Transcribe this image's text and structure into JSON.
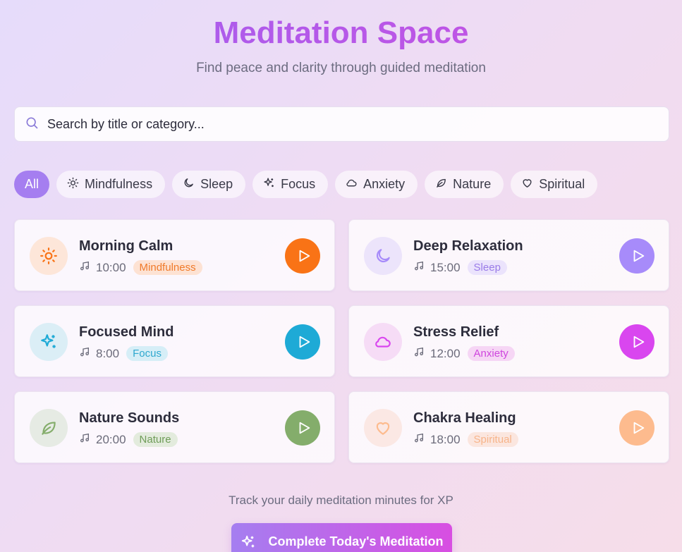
{
  "header": {
    "title": "Meditation Space",
    "subtitle": "Find peace and clarity through guided meditation"
  },
  "search": {
    "placeholder": "Search by title or category...",
    "value": ""
  },
  "filters": [
    {
      "label": "All",
      "icon": "none",
      "active": true
    },
    {
      "label": "Mindfulness",
      "icon": "sun-icon"
    },
    {
      "label": "Sleep",
      "icon": "moon-icon"
    },
    {
      "label": "Focus",
      "icon": "sparkles-icon"
    },
    {
      "label": "Anxiety",
      "icon": "cloud-icon"
    },
    {
      "label": "Nature",
      "icon": "leaf-icon"
    },
    {
      "label": "Spiritual",
      "icon": "heart-icon"
    }
  ],
  "sessions": [
    {
      "title": "Morning Calm",
      "duration": "10:00",
      "category": "Mindfulness",
      "icon": "sun-icon",
      "color": "#f97316"
    },
    {
      "title": "Deep Relaxation",
      "duration": "15:00",
      "category": "Sleep",
      "icon": "moon-icon",
      "color": "#a78bfa"
    },
    {
      "title": "Focused Mind",
      "duration": "8:00",
      "category": "Focus",
      "icon": "sparkles-icon",
      "color": "#1eaad6"
    },
    {
      "title": "Stress Relief",
      "duration": "12:00",
      "category": "Anxiety",
      "icon": "cloud-icon",
      "color": "#d946ef"
    },
    {
      "title": "Nature Sounds",
      "duration": "20:00",
      "category": "Nature",
      "icon": "leaf-icon",
      "color": "#84ad6b"
    },
    {
      "title": "Chakra Healing",
      "duration": "18:00",
      "category": "Spiritual",
      "icon": "heart-icon",
      "color": "#fdbb8e"
    }
  ],
  "footer": {
    "note": "Track your daily meditation minutes for XP",
    "button_label": "Complete Today's Meditation"
  },
  "colors": {
    "accent": "#a57ef0",
    "accent_end": "#d84ee2"
  }
}
